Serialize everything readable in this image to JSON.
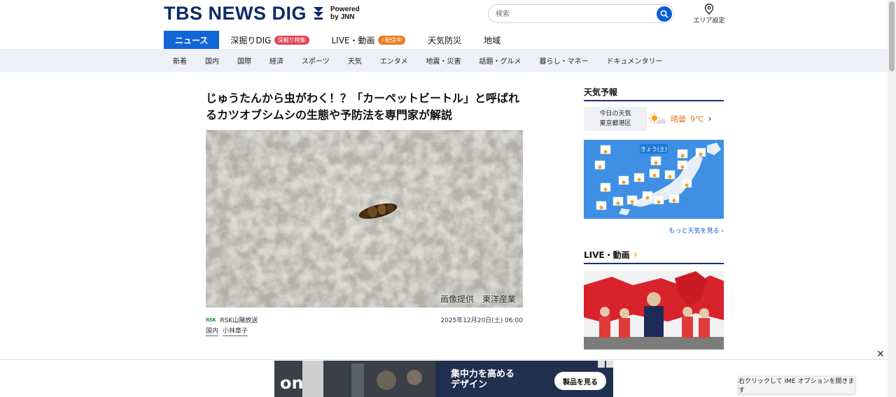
{
  "header": {
    "logo_text": "TBS NEWS DIG",
    "powered_line1": "Powered",
    "powered_line2": "by JNN",
    "search_placeholder": "検索",
    "area_label": "エリア設定"
  },
  "main_nav": [
    {
      "label": "ニュース",
      "active": true
    },
    {
      "label": "深掘りDIG",
      "badge": "深掘り特集",
      "badge_color": "#e2485c"
    },
    {
      "label": "LIVE・動画",
      "badge": "配信中",
      "badge_color": "#ef7b1f"
    },
    {
      "label": "天気防災"
    },
    {
      "label": "地域"
    }
  ],
  "sub_nav": [
    "新着",
    "国内",
    "国際",
    "経済",
    "スポーツ",
    "天気",
    "エンタメ",
    "地震・災害",
    "話題・グルメ",
    "暮らし・マネー",
    "ドキュメンタリー"
  ],
  "article": {
    "title": "じゅうたんから虫がわく！？「カーペットビートル」と呼ばれるカツオブシムシの生態や予防法を専門家が解説",
    "image_credit": "画像提供　東洋産業",
    "station_logo": "RSK",
    "station": "RSK山陽放送",
    "date": "2025年12月20日(土) 06:00",
    "tags": [
      "国内",
      "小林章子"
    ]
  },
  "sidebar": {
    "weather_heading": "天気予報",
    "today_label": "今日の天気",
    "location": "東京都港区",
    "weather_text": "晴曇",
    "temperature": "9℃",
    "map_title": "きょう(土)",
    "more_weather": "もっと天気を見る",
    "live_heading": "LIVE・動画"
  },
  "ad": {
    "headline_line1": "集中力を高める",
    "headline_line2": "デザイン",
    "button": "製品を見る"
  },
  "ime_tip": "右クリックして IME オプションを開きます",
  "colors": {
    "brand_navy": "#0b2a6b",
    "nav_active": "#1166d8",
    "subnav_bg": "#edf0f6",
    "accent_orange": "#e07a1b"
  }
}
